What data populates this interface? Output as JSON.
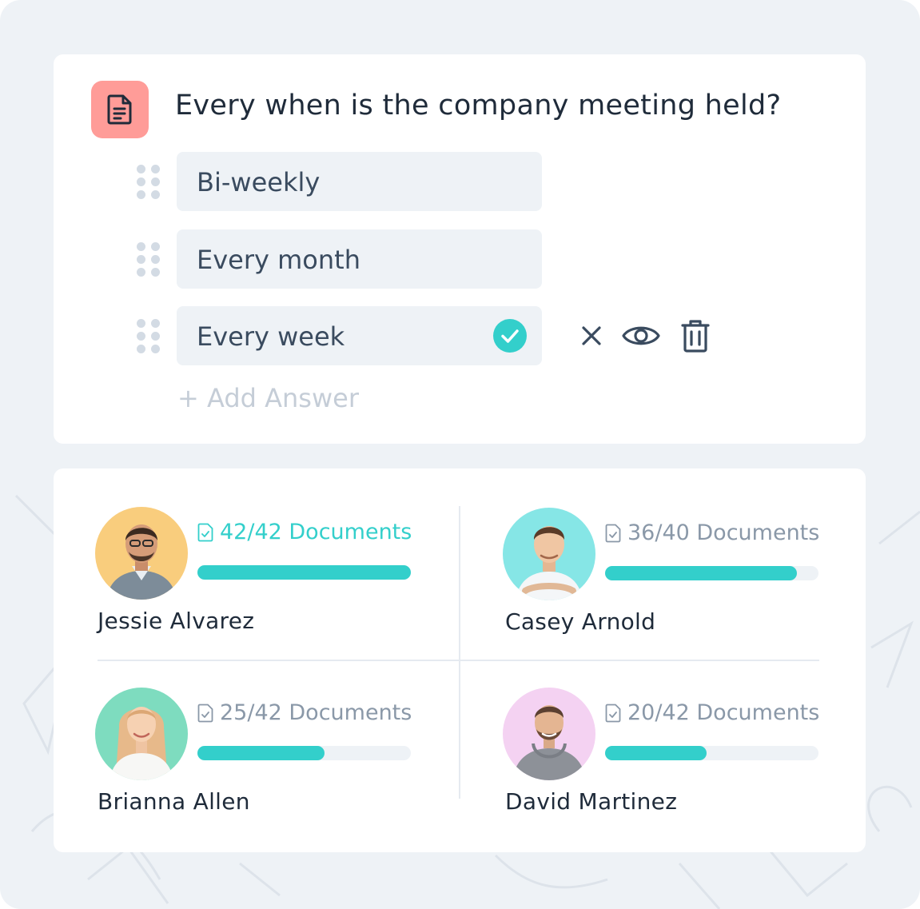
{
  "colors": {
    "accent": "#33cfcb",
    "badge": "#ff9c98",
    "muted": "#8a98a8",
    "text": "#1f2b3a"
  },
  "quiz": {
    "question": "Every when is the company meeting held?",
    "icon": "document-icon",
    "answers": [
      {
        "label": "Bi-weekly",
        "correct": false
      },
      {
        "label": "Every month",
        "correct": false
      },
      {
        "label": "Every week",
        "correct": true
      }
    ],
    "row_actions": [
      "close-icon",
      "eye-icon",
      "trash-icon"
    ],
    "add_answer_label": "+ Add Answer"
  },
  "team": {
    "members": [
      {
        "name": "Jessie Alvarez",
        "documents": "42/42 Documents",
        "progress": 1.0,
        "avatar_bg": "#f9cd7d",
        "count_color": "#33cfcb"
      },
      {
        "name": "Casey Arnold",
        "documents": "36/40 Documents",
        "progress": 0.9,
        "avatar_bg": "#86e6e6",
        "count_color": "#8a98a8"
      },
      {
        "name": "Brianna Allen",
        "documents": "25/42 Documents",
        "progress": 0.595,
        "avatar_bg": "#7edcbf",
        "count_color": "#8a98a8"
      },
      {
        "name": "David Martinez",
        "documents": "20/42 Documents",
        "progress": 0.476,
        "avatar_bg": "#f4d2f2",
        "count_color": "#8a98a8"
      }
    ]
  }
}
